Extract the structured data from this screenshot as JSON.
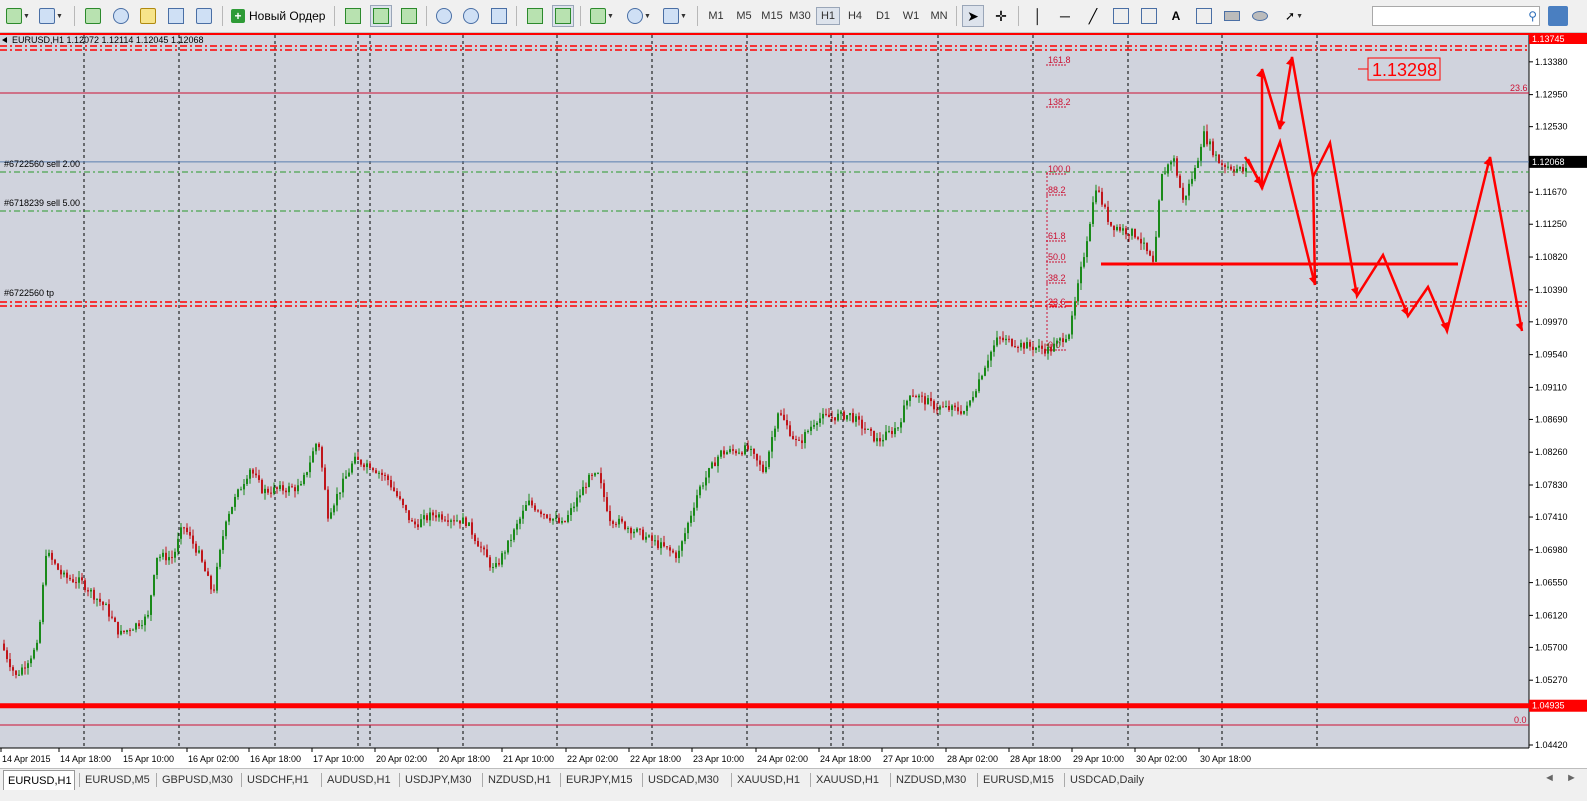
{
  "toolbar": {
    "new_order_label": "Новый Ордер",
    "timeframes": [
      "M1",
      "M5",
      "M15",
      "M30",
      "H1",
      "H4",
      "D1",
      "W1",
      "MN"
    ],
    "active_timeframe": "H1",
    "search": {
      "value": "",
      "placeholder": ""
    }
  },
  "chart": {
    "header": "EURUSD,H1  1.12072 1.12114 1.12045 1.12068",
    "price_scale": [
      "1.13745",
      "1.13380",
      "1.12950",
      "1.12530",
      "1.12068",
      "1.11670",
      "1.11250",
      "1.10820",
      "1.10390",
      "1.09970",
      "1.09540",
      "1.09110",
      "1.08690",
      "1.08260",
      "1.07830",
      "1.07410",
      "1.06980",
      "1.06550",
      "1.06120",
      "1.05700",
      "1.05270",
      "1.04935",
      "1.04420"
    ],
    "current_price": "1.12068",
    "support_price": "1.04935",
    "top_price": "1.13745",
    "time_labels": [
      "14 Apr 2015",
      "14 Apr 18:00",
      "15 Apr 10:00",
      "16 Apr 02:00",
      "16 Apr 18:00",
      "17 Apr 10:00",
      "20 Apr 02:00",
      "20 Apr 18:00",
      "21 Apr 10:00",
      "22 Apr 02:00",
      "22 Apr 18:00",
      "23 Apr 10:00",
      "24 Apr 02:00",
      "24 Apr 18:00",
      "27 Apr 10:00",
      "28 Apr 02:00",
      "28 Apr 18:00",
      "29 Apr 10:00",
      "30 Apr 02:00",
      "30 Apr 18:00"
    ],
    "order_labels": [
      "#6722560 sell 2.00",
      "#6718239 sell 5.00",
      "#6722560 tp"
    ],
    "fib_levels": [
      "161.8",
      "138.2",
      "100.0",
      "88.2",
      "61.8",
      "50.0",
      "38.2",
      "23.6",
      "0.0"
    ],
    "fib_right": {
      "top": "23.6",
      "bottom": "0.0"
    },
    "target_price": "1.13298",
    "colors": {
      "background": "#d0d3dd",
      "bull": "#1a8a1a",
      "bear": "#c0161b",
      "accent": "#ff0000",
      "fib": "#cc1133"
    }
  },
  "tabs": [
    "EURUSD,H1",
    "EURUSD,M5",
    "GBPUSD,M30",
    "USDCHF,H1",
    "AUDUSD,H1",
    "USDJPY,M30",
    "NZDUSD,H1",
    "EURJPY,M15",
    "USDCAD,M30",
    "XAUUSD,H1",
    "XAUUSD,H1",
    "NZDUSD,M30",
    "EURUSD,M15",
    "USDCAD,Daily"
  ],
  "active_tab": "EURUSD,H1"
}
